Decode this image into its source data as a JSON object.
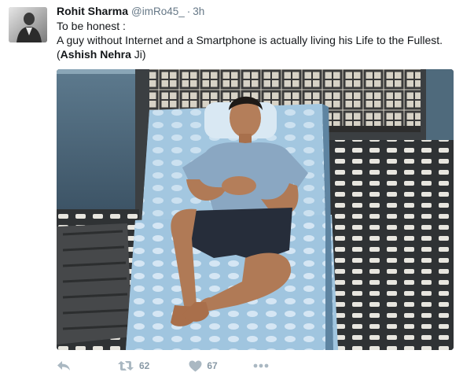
{
  "tweet": {
    "author_name": "Rohit Sharma",
    "handle": "@imRo45_",
    "separator": "·",
    "time": "3h",
    "text": {
      "line1": "To be honest :",
      "line2": "A guy without Internet and a Smartphone is actually living his Life to the Fullest.",
      "line3_open": "(",
      "line3_bold": "Ashish Nehra",
      "line3_rest": " Ji)"
    },
    "actions": {
      "retweet_count": "62",
      "like_count": "67"
    }
  },
  "icons": {
    "avatar": "avatar",
    "photo": "tweet-photo",
    "reply": "reply-icon",
    "retweet": "retweet-icon",
    "like": "heart-icon",
    "more": "more-icon"
  },
  "colors": {
    "text": "#14171a",
    "secondary": "#657786",
    "action_icon": "#aab8c2",
    "action_count": "#8899a6"
  }
}
